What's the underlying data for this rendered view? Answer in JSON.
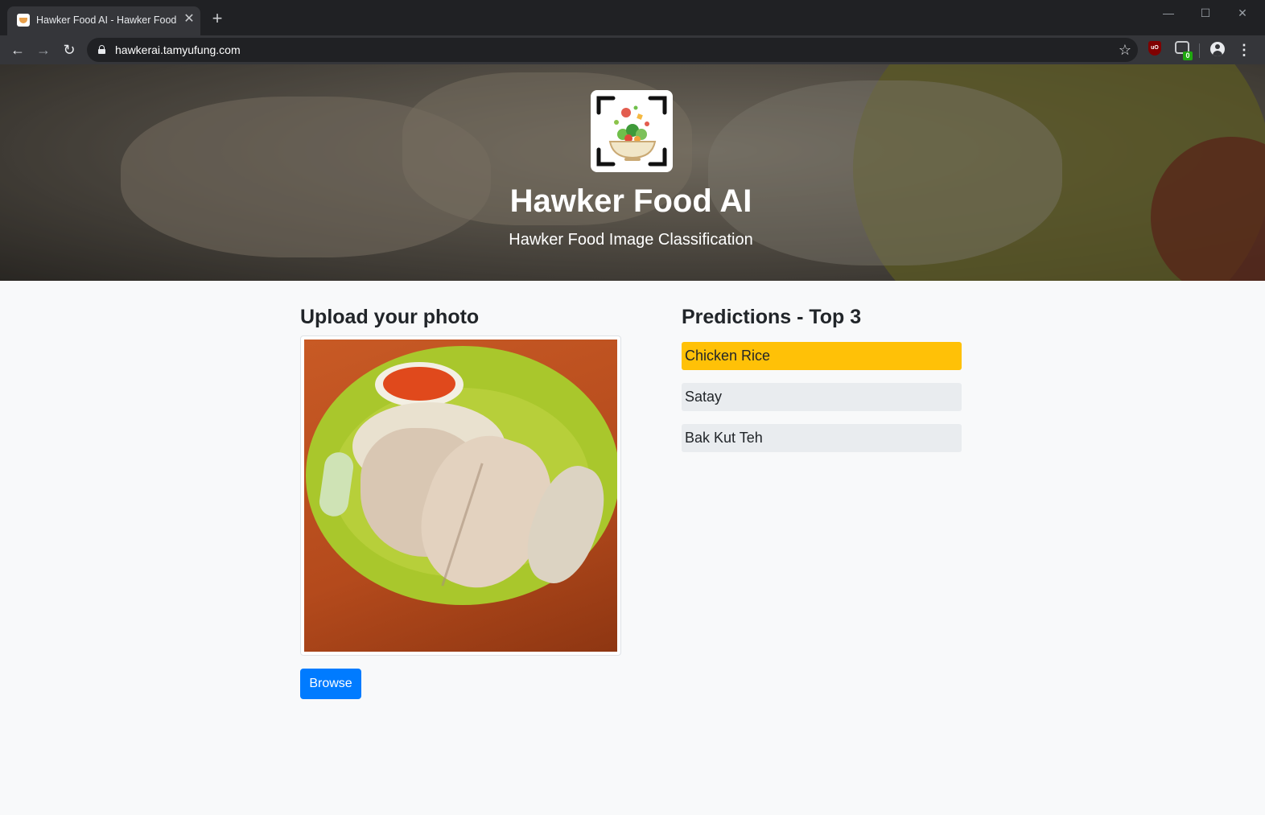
{
  "browser": {
    "tab_title": "Hawker Food AI - Hawker Food Image Classification",
    "close_glyph": "✕",
    "new_tab_glyph": "+",
    "url": "hawkerai.tamyufung.com",
    "ublock_label": "uO",
    "extension_badge": "0",
    "controls": {
      "minimize": "—",
      "maximize": "☐",
      "close": "✕"
    },
    "nav": {
      "back": "←",
      "forward": "→",
      "reload": "↻",
      "star": "☆",
      "menu": "⋮"
    },
    "icons": [
      "back-arrow-icon",
      "forward-arrow-icon",
      "reload-icon",
      "lock-icon",
      "star-icon",
      "ublock-icon",
      "extension-icon",
      "profile-icon",
      "menu-icon"
    ]
  },
  "hero": {
    "title": "Hawker Food AI",
    "subtitle": "Hawker Food Image Classification",
    "logo": "food-scan-logo"
  },
  "upload": {
    "heading": "Upload your photo",
    "photo_alt": "chicken rice photo",
    "browse_label": "Browse"
  },
  "predictions": {
    "heading": "Predictions - Top 3",
    "items": [
      {
        "label": "Chicken Rice",
        "color": "#ffc107"
      },
      {
        "label": "Satay",
        "color": "#e9ecef"
      },
      {
        "label": "Bak Kut Teh",
        "color": "#e9ecef"
      }
    ]
  },
  "colors": {
    "primary": "#007bff",
    "top_prediction": "#ffc107",
    "other_prediction": "#e9ecef",
    "page_bg": "#f8f9fa"
  }
}
